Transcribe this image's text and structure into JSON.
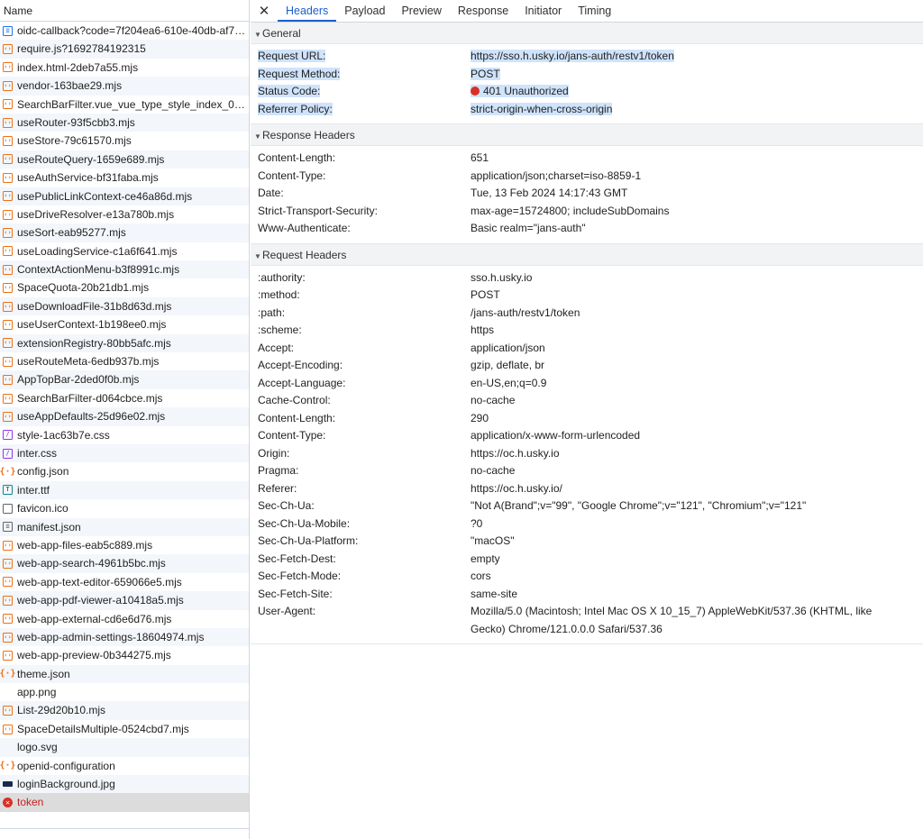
{
  "left_panel": {
    "header": "Name",
    "requests": [
      {
        "name": "oidc-callback?code=7f204ea6-610e-40db-af7…",
        "icon": "doc-icon",
        "cls": "ic-doc",
        "glyph": "≡"
      },
      {
        "name": "require.js?1692784192315",
        "icon": "script-icon",
        "cls": "ic-js",
        "glyph": "‹›"
      },
      {
        "name": "index.html-2deb7a55.mjs",
        "icon": "script-icon",
        "cls": "ic-js",
        "glyph": "‹›"
      },
      {
        "name": "vendor-163bae29.mjs",
        "icon": "script-icon",
        "cls": "ic-js",
        "glyph": "‹›"
      },
      {
        "name": "SearchBarFilter.vue_vue_type_style_index_0_l…",
        "icon": "script-icon",
        "cls": "ic-js",
        "glyph": "‹›"
      },
      {
        "name": "useRouter-93f5cbb3.mjs",
        "icon": "script-icon",
        "cls": "ic-js",
        "glyph": "‹›"
      },
      {
        "name": "useStore-79c61570.mjs",
        "icon": "script-icon",
        "cls": "ic-js",
        "glyph": "‹›"
      },
      {
        "name": "useRouteQuery-1659e689.mjs",
        "icon": "script-icon",
        "cls": "ic-js",
        "glyph": "‹›"
      },
      {
        "name": "useAuthService-bf31faba.mjs",
        "icon": "script-icon",
        "cls": "ic-js",
        "glyph": "‹›"
      },
      {
        "name": "usePublicLinkContext-ce46a86d.mjs",
        "icon": "script-icon",
        "cls": "ic-js",
        "glyph": "‹›"
      },
      {
        "name": "useDriveResolver-e13a780b.mjs",
        "icon": "script-icon",
        "cls": "ic-js",
        "glyph": "‹›"
      },
      {
        "name": "useSort-eab95277.mjs",
        "icon": "script-icon",
        "cls": "ic-js",
        "glyph": "‹›"
      },
      {
        "name": "useLoadingService-c1a6f641.mjs",
        "icon": "script-icon",
        "cls": "ic-js",
        "glyph": "‹›"
      },
      {
        "name": "ContextActionMenu-b3f8991c.mjs",
        "icon": "script-icon",
        "cls": "ic-js",
        "glyph": "‹›"
      },
      {
        "name": "SpaceQuota-20b21db1.mjs",
        "icon": "script-icon",
        "cls": "ic-js",
        "glyph": "‹›"
      },
      {
        "name": "useDownloadFile-31b8d63d.mjs",
        "icon": "script-icon",
        "cls": "ic-js",
        "glyph": "‹›"
      },
      {
        "name": "useUserContext-1b198ee0.mjs",
        "icon": "script-icon",
        "cls": "ic-js",
        "glyph": "‹›"
      },
      {
        "name": "extensionRegistry-80bb5afc.mjs",
        "icon": "script-icon",
        "cls": "ic-js",
        "glyph": "‹›"
      },
      {
        "name": "useRouteMeta-6edb937b.mjs",
        "icon": "script-icon",
        "cls": "ic-js",
        "glyph": "‹›"
      },
      {
        "name": "AppTopBar-2ded0f0b.mjs",
        "icon": "script-icon",
        "cls": "ic-js",
        "glyph": "‹›"
      },
      {
        "name": "SearchBarFilter-d064cbce.mjs",
        "icon": "script-icon",
        "cls": "ic-js",
        "glyph": "‹›"
      },
      {
        "name": "useAppDefaults-25d96e02.mjs",
        "icon": "script-icon",
        "cls": "ic-js",
        "glyph": "‹›"
      },
      {
        "name": "style-1ac63b7e.css",
        "icon": "stylesheet-icon",
        "cls": "ic-css",
        "glyph": "∕"
      },
      {
        "name": "inter.css",
        "icon": "stylesheet-icon",
        "cls": "ic-css",
        "glyph": "∕"
      },
      {
        "name": "config.json",
        "icon": "json-icon",
        "cls": "ic-json",
        "glyph": "{·}"
      },
      {
        "name": "inter.ttf",
        "icon": "font-icon",
        "cls": "ic-font",
        "glyph": "T"
      },
      {
        "name": "favicon.ico",
        "icon": "file-icon",
        "cls": "ic-file",
        "glyph": ""
      },
      {
        "name": "manifest.json",
        "icon": "file-icon",
        "cls": "ic-file",
        "glyph": "≡"
      },
      {
        "name": "web-app-files-eab5c889.mjs",
        "icon": "script-icon",
        "cls": "ic-js",
        "glyph": "‹›"
      },
      {
        "name": "web-app-search-4961b5bc.mjs",
        "icon": "script-icon",
        "cls": "ic-js",
        "glyph": "‹›"
      },
      {
        "name": "web-app-text-editor-659066e5.mjs",
        "icon": "script-icon",
        "cls": "ic-js",
        "glyph": "‹›"
      },
      {
        "name": "web-app-pdf-viewer-a10418a5.mjs",
        "icon": "script-icon",
        "cls": "ic-js",
        "glyph": "‹›"
      },
      {
        "name": "web-app-external-cd6e6d76.mjs",
        "icon": "script-icon",
        "cls": "ic-js",
        "glyph": "‹›"
      },
      {
        "name": "web-app-admin-settings-18604974.mjs",
        "icon": "script-icon",
        "cls": "ic-js",
        "glyph": "‹›"
      },
      {
        "name": "web-app-preview-0b344275.mjs",
        "icon": "script-icon",
        "cls": "ic-js",
        "glyph": "‹›"
      },
      {
        "name": "theme.json",
        "icon": "json-icon",
        "cls": "ic-json",
        "glyph": "{·}"
      },
      {
        "name": "app.png",
        "icon": "image-icon",
        "cls": "ic-blank",
        "glyph": ""
      },
      {
        "name": "List-29d20b10.mjs",
        "icon": "script-icon",
        "cls": "ic-js",
        "glyph": "‹›"
      },
      {
        "name": "SpaceDetailsMultiple-0524cbd7.mjs",
        "icon": "script-icon",
        "cls": "ic-js",
        "glyph": "‹›"
      },
      {
        "name": "logo.svg",
        "icon": "image-icon",
        "cls": "ic-blank",
        "glyph": ""
      },
      {
        "name": "openid-configuration",
        "icon": "json-icon",
        "cls": "ic-json",
        "glyph": "{·}"
      },
      {
        "name": "loginBackground.jpg",
        "icon": "image-icon",
        "cls": "ic-img",
        "glyph": ""
      },
      {
        "name": "token",
        "icon": "error-icon",
        "cls": "ic-error",
        "glyph": "✕",
        "error": true,
        "selected": true
      }
    ]
  },
  "tabs": {
    "close": "✕",
    "items": [
      "Headers",
      "Payload",
      "Preview",
      "Response",
      "Initiator",
      "Timing"
    ],
    "active": "Headers"
  },
  "sections": [
    {
      "title": "General",
      "highlight": true,
      "rows": [
        {
          "key": "Request URL:",
          "value": "https://sso.h.usky.io/jans-auth/restv1/token"
        },
        {
          "key": "Request Method:",
          "value": "POST"
        },
        {
          "key": "Status Code:",
          "value": "401 Unauthorized",
          "status_dot": true
        },
        {
          "key": "Referrer Policy:",
          "value": "strict-origin-when-cross-origin"
        }
      ]
    },
    {
      "title": "Response Headers",
      "rows": [
        {
          "key": "Content-Length:",
          "value": "651"
        },
        {
          "key": "Content-Type:",
          "value": "application/json;charset=iso-8859-1"
        },
        {
          "key": "Date:",
          "value": "Tue, 13 Feb 2024 14:17:43 GMT"
        },
        {
          "key": "Strict-Transport-Security:",
          "value": "max-age=15724800; includeSubDomains"
        },
        {
          "key": "Www-Authenticate:",
          "value": "Basic realm=\"jans-auth\""
        }
      ]
    },
    {
      "title": "Request Headers",
      "rows": [
        {
          "key": ":authority:",
          "value": "sso.h.usky.io"
        },
        {
          "key": ":method:",
          "value": "POST"
        },
        {
          "key": ":path:",
          "value": "/jans-auth/restv1/token"
        },
        {
          "key": ":scheme:",
          "value": "https"
        },
        {
          "key": "Accept:",
          "value": "application/json"
        },
        {
          "key": "Accept-Encoding:",
          "value": "gzip, deflate, br"
        },
        {
          "key": "Accept-Language:",
          "value": "en-US,en;q=0.9"
        },
        {
          "key": "Cache-Control:",
          "value": "no-cache"
        },
        {
          "key": "Content-Length:",
          "value": "290"
        },
        {
          "key": "Content-Type:",
          "value": "application/x-www-form-urlencoded"
        },
        {
          "key": "Origin:",
          "value": "https://oc.h.usky.io"
        },
        {
          "key": "Pragma:",
          "value": "no-cache"
        },
        {
          "key": "Referer:",
          "value": "https://oc.h.usky.io/"
        },
        {
          "key": "Sec-Ch-Ua:",
          "value": "\"Not A(Brand\";v=\"99\", \"Google Chrome\";v=\"121\", \"Chromium\";v=\"121\""
        },
        {
          "key": "Sec-Ch-Ua-Mobile:",
          "value": "?0"
        },
        {
          "key": "Sec-Ch-Ua-Platform:",
          "value": "\"macOS\""
        },
        {
          "key": "Sec-Fetch-Dest:",
          "value": "empty"
        },
        {
          "key": "Sec-Fetch-Mode:",
          "value": "cors"
        },
        {
          "key": "Sec-Fetch-Site:",
          "value": "same-site"
        },
        {
          "key": "User-Agent:",
          "value": "Mozilla/5.0 (Macintosh; Intel Mac OS X 10_15_7) AppleWebKit/537.36 (KHTML, like Gecko) Chrome/121.0.0.0 Safari/537.36"
        }
      ]
    }
  ],
  "colors": {
    "accent": "#1a5fd0",
    "error": "#d93025",
    "highlight": "#cfe3fb"
  }
}
